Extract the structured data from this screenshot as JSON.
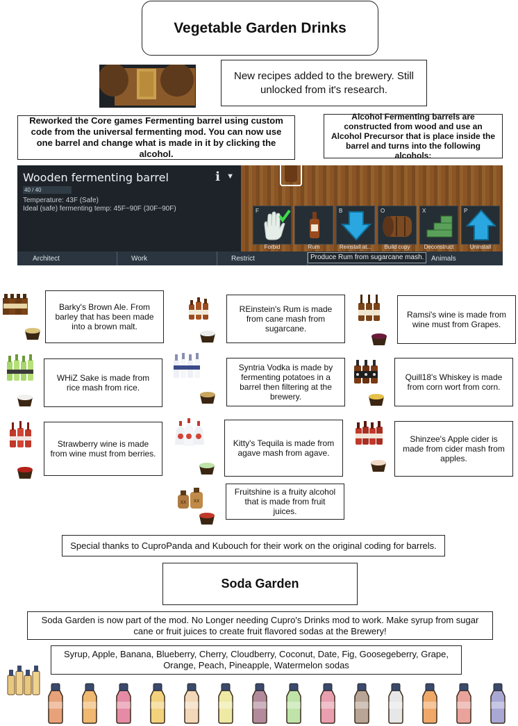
{
  "title": "Vegetable Garden Drinks",
  "intro_note": "New recipes added to the brewery. Still unlocked from it's research.",
  "reworked_note": "Reworked the Core games Fermenting barrel using custom code from the universal fermenting mod. You can now use one barrel and change what is made in it by clicking the alcohol.",
  "barrels_note": "Alcohol Fermenting barrels are constructed from wood and use an Alcohol Precursor that is place inside the barrel and turns into the following alcohols:",
  "game": {
    "inspect_title": "Wooden fermenting barrel",
    "hp": "40 / 40",
    "temperature": "Temperature: 43F (Safe)",
    "ideal_temp": "Ideal (safe) fermenting temp: 45F~90F (30F~90F)",
    "gizmos": [
      {
        "key": "F",
        "label": "Forbid"
      },
      {
        "key": "",
        "label": "Rum"
      },
      {
        "key": "B",
        "label": "Reinstall at..."
      },
      {
        "key": "O",
        "label": "Build copy"
      },
      {
        "key": "X",
        "label": "Deconstruct"
      },
      {
        "key": "P",
        "label": "Uninstall"
      }
    ],
    "tabs": [
      "Architect",
      "Work",
      "Restrict",
      "Animals"
    ],
    "tooltip": "Produce Rum from sugarcane mash."
  },
  "alcohols": [
    {
      "text": "Barky's Brown Ale. From barley that has been made into a brown malt."
    },
    {
      "text": "REinstein's Rum is made from cane mash from sugarcane."
    },
    {
      "text": "Ramsi's wine is made from wine must from Grapes."
    },
    {
      "text": "WHiZ Sake is made from rice mash from rice."
    },
    {
      "text": "Syntria Vodka is made by fermenting potatoes in a barrel then filtering at the brewery."
    },
    {
      "text": "Quill18's Whiskey is made from corn wort from corn."
    },
    {
      "text": "Strawberry wine is made from wine must from berries."
    },
    {
      "text": "Kitty's Tequila is made from agave mash from agave."
    },
    {
      "text": "Shinzee's Apple cider is  made from cider mash from apples."
    },
    {
      "text": "Fruitshine is a fruity alcohol that is made from fruit juices."
    }
  ],
  "thanks": "Special thanks to CuproPanda and Kubouch for their work on the original coding for barrels.",
  "soda_title": "Soda Garden",
  "soda_note": "Soda Garden is now part of the mod. No Longer needing Cupro's Drinks mod to work. Make syrup from sugar cane or fruit juices to create fruit flavored sodas at the Brewery!",
  "soda_list": "Syrup, Apple, Banana, Blueberry, Cherry, Cloudberry, Coconut, Date, Fig, Goosegeberry, Grape, Orange, Peach, Pineapple, Watermelon sodas",
  "colors": {
    "wood": "#8a5425",
    "ui_dark": "#1d2329",
    "gizmo_bg": "#252e35",
    "soda_fills": [
      "#e8a27a",
      "#f0b870",
      "#e58ba6",
      "#f3d27d",
      "#f2d7b8",
      "#eeeaa5",
      "#b38a9c",
      "#bfe3a8",
      "#e99fb0",
      "#b8a595",
      "#e7e7e7",
      "#f0a868",
      "#e9a39b",
      "#a9a8d4"
    ]
  }
}
